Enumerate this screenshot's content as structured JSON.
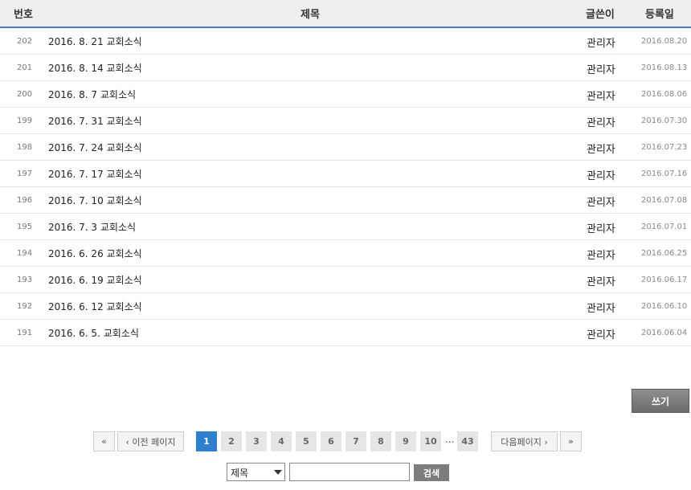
{
  "board": {
    "headers": {
      "num": "번호",
      "title": "제목",
      "writer": "글쓴이",
      "date": "등록일"
    },
    "rows": [
      {
        "num": "202",
        "title": "2016. 8. 21 교회소식",
        "writer": "관리자",
        "date": "2016.08.20"
      },
      {
        "num": "201",
        "title": "2016. 8. 14 교회소식",
        "writer": "관리자",
        "date": "2016.08.13"
      },
      {
        "num": "200",
        "title": "2016. 8. 7 교회소식",
        "writer": "관리자",
        "date": "2016.08.06"
      },
      {
        "num": "199",
        "title": "2016. 7. 31 교회소식",
        "writer": "관리자",
        "date": "2016.07.30"
      },
      {
        "num": "198",
        "title": "2016. 7. 24 교회소식",
        "writer": "관리자",
        "date": "2016.07.23"
      },
      {
        "num": "197",
        "title": "2016. 7. 17 교회소식",
        "writer": "관리자",
        "date": "2016.07.16"
      },
      {
        "num": "196",
        "title": "2016. 7. 10 교회소식",
        "writer": "관리자",
        "date": "2016.07.08"
      },
      {
        "num": "195",
        "title": "2016. 7. 3 교회소식",
        "writer": "관리자",
        "date": "2016.07.01"
      },
      {
        "num": "194",
        "title": "2016. 6. 26 교회소식",
        "writer": "관리자",
        "date": "2016.06.25"
      },
      {
        "num": "193",
        "title": "2016. 6. 19 교회소식",
        "writer": "관리자",
        "date": "2016.06.17"
      },
      {
        "num": "192",
        "title": "2016. 6. 12 교회소식",
        "writer": "관리자",
        "date": "2016.06.10"
      },
      {
        "num": "191",
        "title": "2016. 6. 5. 교회소식",
        "writer": "관리자",
        "date": "2016.06.04"
      }
    ]
  },
  "write_button": "쓰기",
  "pager": {
    "first": "«",
    "prev": "‹ 이전 페이지",
    "pages": [
      "1",
      "2",
      "3",
      "4",
      "5",
      "6",
      "7",
      "8",
      "9",
      "10"
    ],
    "active_page": "1",
    "ellipsis": "...",
    "last_page": "43",
    "next": "다음페이지 ›",
    "last": "»"
  },
  "search": {
    "field_selected": "제목",
    "query_value": "",
    "button": "검색"
  }
}
